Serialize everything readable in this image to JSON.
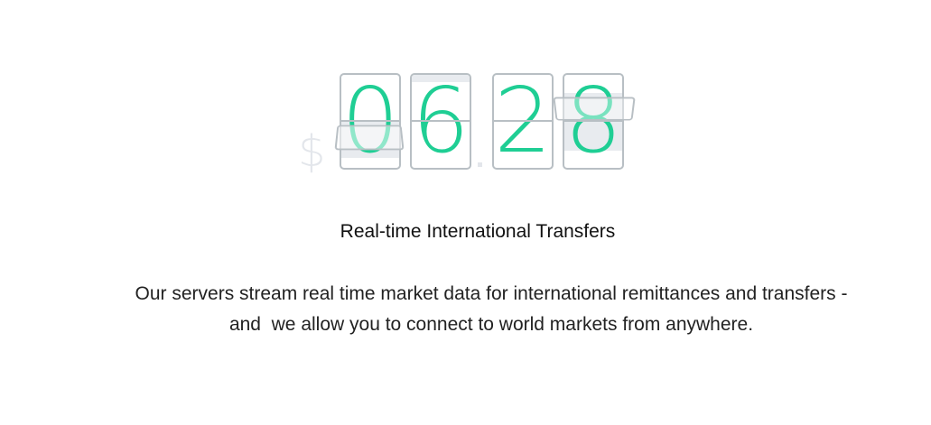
{
  "counter": {
    "currency": "$",
    "digits": [
      "0",
      "6",
      "2",
      "8"
    ],
    "separator": "."
  },
  "feature": {
    "title": "Real-time International Transfers",
    "description_line1": "Our servers stream real time market data for international remittances and transfers -",
    "description_line2": "and  we allow you to connect to world markets from anywhere."
  },
  "colors": {
    "digit": "#1fce94",
    "border": "#b8bfc4"
  }
}
